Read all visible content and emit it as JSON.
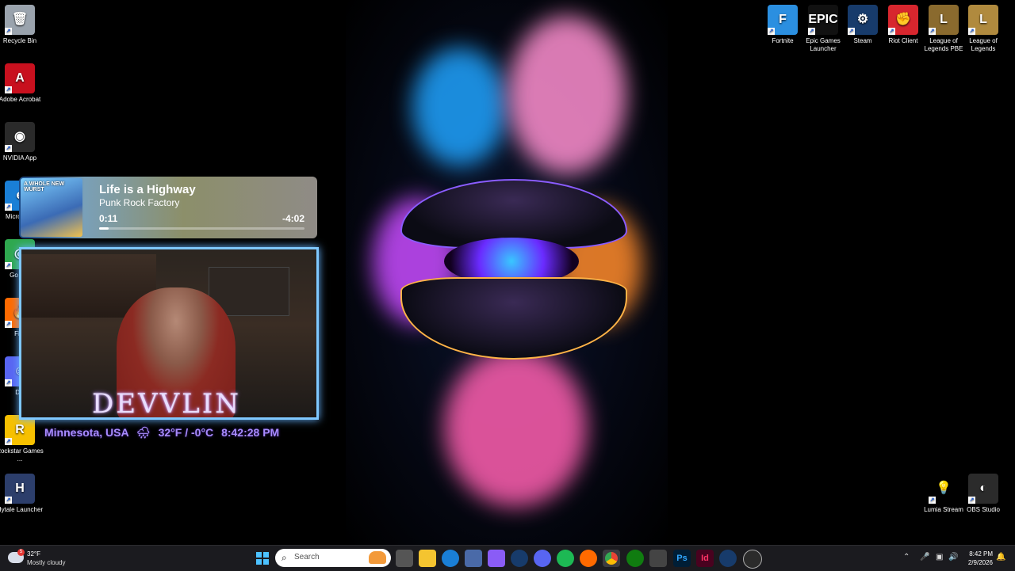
{
  "desktop_left": [
    {
      "label": "Recycle Bin",
      "color": "#9aa3ad",
      "glyph": "🗑"
    },
    {
      "label": "Adobe Acrobat",
      "color": "#c8101e",
      "glyph": "A"
    },
    {
      "label": "NVIDIA App",
      "color": "#2a2a2a",
      "glyph": "◉"
    },
    {
      "label": "Micro Edg",
      "color": "#1a7fd6",
      "glyph": "e"
    },
    {
      "label": "Go Chr",
      "color": "#2fa84f",
      "glyph": "◎"
    },
    {
      "label": "Fire",
      "color": "#ff6a00",
      "glyph": "🔥"
    },
    {
      "label": "Dis",
      "color": "#5865f2",
      "glyph": "☺"
    },
    {
      "label": "Rockstar Games ...",
      "color": "#f6c000",
      "glyph": "R"
    },
    {
      "label": "Hytale Launcher",
      "color": "#2c3e6b",
      "glyph": "H"
    }
  ],
  "desktop_right": [
    {
      "label": "Fortnite",
      "color": "#2b8fe0",
      "glyph": "F"
    },
    {
      "label": "Epic Games Launcher",
      "color": "#111111",
      "glyph": "EPIC"
    },
    {
      "label": "Steam",
      "color": "#173b6b",
      "glyph": "⚙"
    },
    {
      "label": "Riot Client",
      "color": "#d7262e",
      "glyph": "✊"
    },
    {
      "label": "League of Legends PBE",
      "color": "#8a6a2e",
      "glyph": "L"
    },
    {
      "label": "League of Legends",
      "color": "#b08a3e",
      "glyph": "L"
    }
  ],
  "desktop_bottom_right": [
    {
      "label": "Lumia Stream",
      "color": "#000000",
      "glyph": "💡"
    },
    {
      "label": "OBS Studio",
      "color": "#2b2b2b",
      "glyph": "◐"
    }
  ],
  "media": {
    "album_text": "A WHOLE NEW WURST",
    "title": "Life is a Highway",
    "artist": "Punk Rock Factory",
    "elapsed": "0:11",
    "remaining": "-4:02",
    "progress": 0.045
  },
  "overlay": {
    "name": "DEVVLIN",
    "location": "Minnesota, USA",
    "weather_icon": "🌧",
    "temperature": "32°F / -0°C",
    "time": "8:42:28 PM"
  },
  "taskbar": {
    "weather_temp": "32°F",
    "weather_condition": "Mostly cloudy",
    "weather_badge": "5",
    "search_placeholder": "Search",
    "clock_time": "8:42 PM",
    "clock_date": "2/9/2026"
  }
}
